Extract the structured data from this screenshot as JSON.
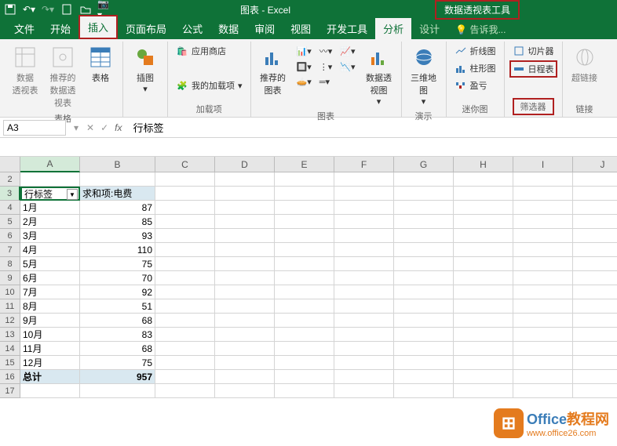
{
  "title_bar": {
    "app_title": "图表 - Excel",
    "context_tab": "数据透视表工具"
  },
  "tabs": {
    "file": "文件",
    "home": "开始",
    "insert": "插入",
    "layout": "页面布局",
    "formulas": "公式",
    "data": "数据",
    "review": "审阅",
    "view": "视图",
    "developer": "开发工具",
    "analyze": "分析",
    "design": "设计",
    "tellme": "告诉我..."
  },
  "ribbon": {
    "tables": {
      "pivot_table": "数据\n透视表",
      "recommended_pivot": "推荐的\n数据透视表",
      "table": "表格",
      "group": "表格"
    },
    "illustrations": {
      "illustration": "插图"
    },
    "addins": {
      "store": "应用商店",
      "myaddins": "我的加载项",
      "group": "加载项"
    },
    "charts": {
      "recommended": "推荐的\n图表",
      "pivot_chart": "数据透视图",
      "group": "图表"
    },
    "tours": {
      "map3d": "三维地\n图",
      "group": "演示"
    },
    "sparklines": {
      "line": "折线图",
      "column": "柱形图",
      "winloss": "盈亏",
      "group": "迷你图"
    },
    "filters": {
      "slicer": "切片器",
      "timeline": "日程表",
      "group": "筛选器"
    },
    "links": {
      "hyperlink": "超链接",
      "group": "链接"
    }
  },
  "namebox": {
    "cell_ref": "A3",
    "fx": "fx",
    "formula_value": "行标签"
  },
  "grid": {
    "columns": [
      "A",
      "B",
      "C",
      "D",
      "E",
      "F",
      "G",
      "H",
      "I",
      "J"
    ],
    "row_numbers": [
      "2",
      "3",
      "4",
      "5",
      "6",
      "7",
      "8",
      "9",
      "10",
      "11",
      "12",
      "13",
      "14",
      "15",
      "16",
      "17"
    ],
    "headers": {
      "a": "行标签",
      "b": "求和项:电费"
    },
    "rows": [
      {
        "label": "1月",
        "value": 87
      },
      {
        "label": "2月",
        "value": 85
      },
      {
        "label": "3月",
        "value": 93
      },
      {
        "label": "4月",
        "value": 110
      },
      {
        "label": "5月",
        "value": 75
      },
      {
        "label": "6月",
        "value": 70
      },
      {
        "label": "7月",
        "value": 92
      },
      {
        "label": "8月",
        "value": 51
      },
      {
        "label": "9月",
        "value": 68
      },
      {
        "label": "10月",
        "value": 83
      },
      {
        "label": "11月",
        "value": 68
      },
      {
        "label": "12月",
        "value": 75
      }
    ],
    "total_label": "总计",
    "total_value": 957
  },
  "watermark": {
    "brand1": "Office",
    "brand2": "教程网",
    "url": "www.office26.com"
  }
}
